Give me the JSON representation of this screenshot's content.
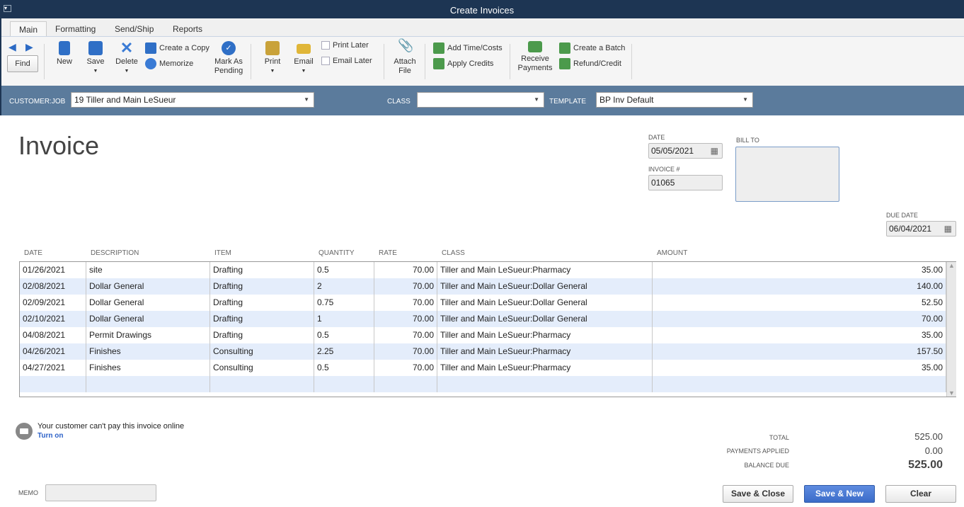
{
  "window": {
    "title": "Create Invoices",
    "menu_icon": "window-menu-icon"
  },
  "tabs": [
    "Main",
    "Formatting",
    "Send/Ship",
    "Reports"
  ],
  "toolbar": {
    "find": "Find",
    "new": "New",
    "save": "Save",
    "delete": "Delete",
    "create_copy": "Create a Copy",
    "memorize": "Memorize",
    "mark_pending": [
      "Mark As",
      "Pending"
    ],
    "print": "Print",
    "email": "Email",
    "print_later": "Print Later",
    "email_later": "Email Later",
    "attach": [
      "Attach",
      "File"
    ],
    "add_time": "Add Time/Costs",
    "apply_credits": "Apply Credits",
    "receive": [
      "Receive",
      "Payments"
    ],
    "create_batch": "Create a Batch",
    "refund": "Refund/Credit"
  },
  "customer_bar": {
    "customer_label": "CUSTOMER:JOB",
    "customer_value": "19 Tiller and Main LeSueur",
    "class_label": "CLASS",
    "class_value": "",
    "template_label": "TEMPLATE",
    "template_value": "BP Inv Default"
  },
  "invoice": {
    "heading": "Invoice",
    "date_label": "DATE",
    "date": "05/05/2021",
    "number_label": "INVOICE #",
    "number": "01065",
    "bill_to_label": "BILL TO",
    "bill_to": "",
    "due_label": "DUE DATE",
    "due_date": "06/04/2021"
  },
  "table": {
    "headers": [
      "DATE",
      "DESCRIPTION",
      "ITEM",
      "QUANTITY",
      "RATE",
      "CLASS",
      "AMOUNT"
    ],
    "rows": [
      [
        "01/26/2021",
        "site",
        "Drafting",
        "0.5",
        "70.00",
        "Tiller and Main LeSueur:Pharmacy",
        "35.00"
      ],
      [
        "02/08/2021",
        "Dollar General",
        "Drafting",
        "2",
        "70.00",
        "Tiller and Main LeSueur:Dollar General",
        "140.00"
      ],
      [
        "02/09/2021",
        "Dollar General",
        "Drafting",
        "0.75",
        "70.00",
        "Tiller and Main LeSueur:Dollar General",
        "52.50"
      ],
      [
        "02/10/2021",
        "Dollar General",
        "Drafting",
        "1",
        "70.00",
        "Tiller and Main LeSueur:Dollar General",
        "70.00"
      ],
      [
        "04/08/2021",
        "Permit Drawings",
        "Drafting",
        "0.5",
        "70.00",
        "Tiller and Main LeSueur:Pharmacy",
        "35.00"
      ],
      [
        "04/26/2021",
        "Finishes",
        "Consulting",
        "2.25",
        "70.00",
        "Tiller and Main LeSueur:Pharmacy",
        "157.50"
      ],
      [
        "04/27/2021",
        "Finishes",
        "Consulting",
        "0.5",
        "70.00",
        "Tiller and Main LeSueur:Pharmacy",
        "35.00"
      ],
      [
        "",
        "",
        "",
        "",
        "",
        "",
        ""
      ]
    ]
  },
  "online": {
    "message": "Your customer can't pay this invoice online",
    "link": "Turn on"
  },
  "totals": {
    "total_label": "TOTAL",
    "total": "525.00",
    "payments_label": "PAYMENTS APPLIED",
    "payments": "0.00",
    "balance_label": "BALANCE DUE",
    "balance": "525.00"
  },
  "memo": {
    "label": "MEMO",
    "value": ""
  },
  "buttons": {
    "save_close": "Save & Close",
    "save_new": "Save & New",
    "clear": "Clear"
  }
}
